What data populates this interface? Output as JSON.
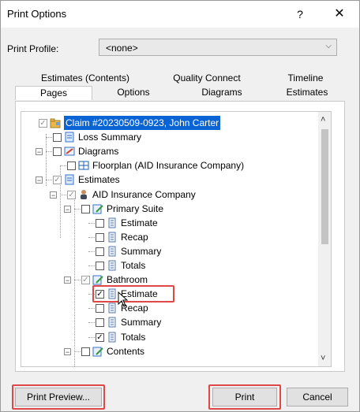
{
  "window": {
    "title": "Print Options",
    "help_glyph": "?",
    "close_glyph": "✕"
  },
  "profile": {
    "label": "Print Profile:",
    "value": "<none>",
    "chevron": "⌵"
  },
  "tabs": {
    "row1": [
      {
        "label": "Estimates (Contents)"
      },
      {
        "label": "Quality Connect"
      },
      {
        "label": "Timeline"
      }
    ],
    "row2": [
      {
        "label": "Pages",
        "active": true
      },
      {
        "label": "Options"
      },
      {
        "label": "Diagrams"
      },
      {
        "label": "Estimates"
      }
    ]
  },
  "tree": {
    "items": [
      {
        "label": "Claim #20230509-0923, John Carter",
        "icon": "folder-claim-icon",
        "checked": true,
        "selected": true
      },
      {
        "label": "Loss Summary",
        "icon": "document-icon",
        "checked": false
      },
      {
        "label": "Diagrams",
        "icon": "diagram-icon",
        "checked": false
      },
      {
        "label": "Floorplan (AID Insurance Company)",
        "icon": "floorplan-icon",
        "checked": false
      },
      {
        "label": "Estimates",
        "icon": "document-icon",
        "checked": true
      },
      {
        "label": "AID Insurance Company",
        "icon": "person-icon",
        "checked": true
      },
      {
        "label": "Primary Suite",
        "icon": "edit-document-icon",
        "checked": false
      },
      {
        "label": "Estimate",
        "icon": "page-icon",
        "checked": false
      },
      {
        "label": "Recap",
        "icon": "page-icon",
        "checked": false
      },
      {
        "label": "Summary",
        "icon": "page-icon",
        "checked": false
      },
      {
        "label": "Totals",
        "icon": "page-icon",
        "checked": false
      },
      {
        "label": "Bathroom",
        "icon": "edit-document-icon",
        "checked": true
      },
      {
        "label": "Estimate",
        "icon": "page-icon",
        "checked": true,
        "highlighted": true
      },
      {
        "label": "Recap",
        "icon": "page-icon",
        "checked": false
      },
      {
        "label": "Summary",
        "icon": "page-icon",
        "checked": false
      },
      {
        "label": "Totals",
        "icon": "page-icon",
        "checked": true
      },
      {
        "label": "Contents",
        "icon": "edit-document-icon",
        "checked": false
      }
    ],
    "expander_minus": "−",
    "check_glyph": "✓",
    "scroll_up": "˄",
    "scroll_down": "˅"
  },
  "buttons": {
    "print_preview": "Print Preview...",
    "print": "Print",
    "cancel": "Cancel"
  },
  "colors": {
    "selection": "#0a64d6",
    "highlight": "#e04848",
    "dialog_bg": "#f0f0f0"
  }
}
